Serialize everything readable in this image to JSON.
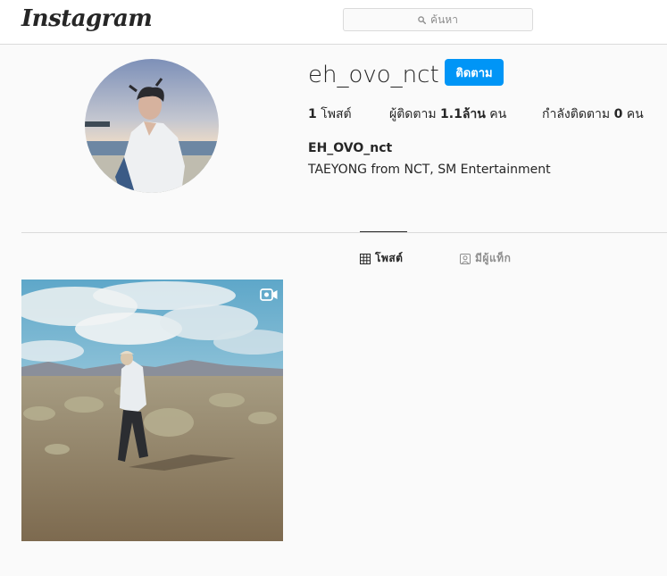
{
  "header": {
    "logo_text": "Instagram",
    "search_placeholder": "ค้นหา"
  },
  "profile": {
    "username": "eh_ovo_nct",
    "follow_label": "ติดตาม",
    "stats": {
      "posts_count": "1",
      "posts_label": " โพสต์",
      "followers_prefix": "ผู้ติดตาม ",
      "followers_count": "1.1ล้าน",
      "followers_suffix": " คน",
      "following_prefix": "กำลังติดตาม ",
      "following_count": "0",
      "following_suffix": " คน"
    },
    "full_name": "EH_OVO_nct",
    "bio": "TAEYONG from NCT, SM Entertainment"
  },
  "tabs": [
    {
      "label": "โพสต์",
      "icon": "grid-icon",
      "active": true
    },
    {
      "label": "มีผู้แท็ก",
      "icon": "tagged-icon",
      "active": false
    }
  ],
  "posts": [
    {
      "type": "video",
      "icon": "video-icon"
    }
  ],
  "colors": {
    "accent": "#0095f6",
    "text": "#262626",
    "muted": "#8e8e8e",
    "border": "#dbdbdb",
    "background": "#fafafa"
  }
}
